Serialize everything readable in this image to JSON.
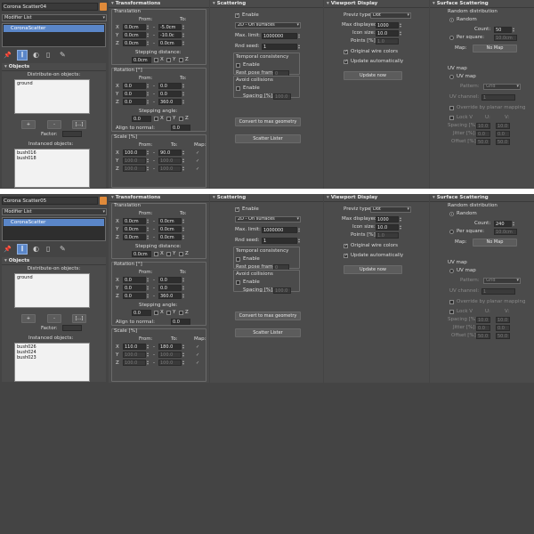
{
  "instances": [
    {
      "object_name": "Corona Scatter04",
      "color_swatch": "#e08a3a",
      "modifier_list": "Modifier List",
      "stack_item": "CoronaScatter",
      "objects": {
        "title": "Objects",
        "distribute_label": "Distribute-on objects:",
        "distribute_items": [
          "ground"
        ],
        "plus": "+",
        "minus": "-",
        "more": "[...]",
        "factor_label": "Factor:",
        "factor_value": "",
        "instanced_label": "Instanced objects:",
        "instanced_items": [
          "bush016",
          "bush018"
        ]
      },
      "transformations": {
        "title": "Transformations",
        "translation": "Translation",
        "from": "From:",
        "to": "To:",
        "tx_from": [
          "0.0cm",
          "0.0cm",
          "0.0cm"
        ],
        "tx_to": [
          "-5.0cm",
          "-10.0c",
          "0.0cm"
        ],
        "stepping_distance": "Stepping distance:",
        "step_dist": "0.0cm",
        "axis_x": "X",
        "axis_y": "Y",
        "axis_z": "Z",
        "rotation": "Rotation [°]",
        "rot_from": [
          "0.0",
          "0.0",
          "0.0"
        ],
        "rot_to": [
          "0.0",
          "0.0",
          "360.0"
        ],
        "stepping_angle": "Stepping angle:",
        "step_angle": "0.0",
        "align_normal": "Align to normal:",
        "align_val": "0.0",
        "scale": "Scale [%]",
        "map": "Map:",
        "sc_from": [
          "100.0",
          "100.0",
          "100.0"
        ],
        "sc_to": [
          "90.0",
          "100.0",
          "100.0"
        ]
      },
      "scattering": {
        "title": "Scattering",
        "enable": "Enable",
        "mode": "2D - On surfaces",
        "max_limit_label": "Max. limit:",
        "max_limit": "1000000",
        "rnd_seed_label": "Rnd seed:",
        "rnd_seed": "1",
        "temporal": "Temporal consistency",
        "t_enable": "Enable",
        "rest_pose": "Rest pose frame",
        "rest_pose_val": "0",
        "avoid": "Avoid collisions",
        "a_enable": "Enable",
        "spacing": "Spacing [%]:",
        "spacing_val": "100.0",
        "convert": "Convert to max geometry",
        "lister": "Scatter Lister"
      },
      "viewport": {
        "title": "Viewport Display",
        "previz_label": "Previz type:",
        "previz": "Dot",
        "max_disp_label": "Max displayed:",
        "max_disp": "1000",
        "icon_size_label": "Icon size:",
        "icon_size": "10.0",
        "points_label": "Points [%]:",
        "points": "1.0",
        "orig_wire": "Original wire colors",
        "update_auto": "Update automatically",
        "update_now": "Update now"
      },
      "surface": {
        "title": "Surface Scattering",
        "random_dist": "Random distribution",
        "random": "Random",
        "count_label": "Count:",
        "count": "50",
        "per_square": "Per square:",
        "per_square_val": "10.0cm",
        "map_label": "Map:",
        "no_map": "No Map",
        "uv_map_group": "UV map",
        "uv_map": "UV map",
        "pattern_label": "Pattern:",
        "pattern": "Grid",
        "uv_channel_label": "UV channel:",
        "uv_channel": "1",
        "override": "Override by planar mapping",
        "lock": "Lock V",
        "u": "U:",
        "v": "V:",
        "spacing_label": "Spacing [%]:",
        "jitter_label": "Jitter [%]:",
        "offset_label": "Offset [%]:",
        "spacing_u": "10.0",
        "spacing_v": "10.0",
        "jitter_u": "0.0",
        "jitter_v": "0.0",
        "offset_u": "50.0",
        "offset_v": "50.0"
      }
    },
    {
      "object_name": "Corona Scatter05",
      "color_swatch": "#e08a3a",
      "modifier_list": "Modifier List",
      "stack_item": "CoronaScatter",
      "objects": {
        "title": "Objects",
        "distribute_label": "Distribute-on objects:",
        "distribute_items": [
          "ground"
        ],
        "plus": "+",
        "minus": "-",
        "more": "[...]",
        "factor_label": "Factor:",
        "factor_value": "",
        "instanced_label": "Instanced objects:",
        "instanced_items": [
          "bush026",
          "bush024",
          "bush023"
        ]
      },
      "transformations": {
        "title": "Transformations",
        "translation": "Translation",
        "from": "From:",
        "to": "To:",
        "tx_from": [
          "0.0cm",
          "0.0cm",
          "0.0cm"
        ],
        "tx_to": [
          "0.0cm",
          "0.0cm",
          "0.0cm"
        ],
        "stepping_distance": "Stepping distance:",
        "step_dist": "0.0cm",
        "axis_x": "X",
        "axis_y": "Y",
        "axis_z": "Z",
        "rotation": "Rotation [°]",
        "rot_from": [
          "0.0",
          "0.0",
          "0.0"
        ],
        "rot_to": [
          "0.0",
          "0.0",
          "360.0"
        ],
        "stepping_angle": "Stepping angle:",
        "step_angle": "0.0",
        "align_normal": "Align to normal:",
        "align_val": "0.0",
        "scale": "Scale [%]",
        "map": "Map:",
        "sc_from": [
          "110.0",
          "100.0",
          "100.0"
        ],
        "sc_to": [
          "180.0",
          "100.0",
          "100.0"
        ]
      },
      "scattering": {
        "title": "Scattering",
        "enable": "Enable",
        "mode": "2D - On surfaces",
        "max_limit_label": "Max. limit:",
        "max_limit": "1000000",
        "rnd_seed_label": "Rnd seed:",
        "rnd_seed": "1",
        "temporal": "Temporal consistency",
        "t_enable": "Enable",
        "rest_pose": "Rest pose frame",
        "rest_pose_val": "0",
        "avoid": "Avoid collisions",
        "a_enable": "Enable",
        "spacing": "Spacing [%]:",
        "spacing_val": "100.0",
        "convert": "Convert to max geometry",
        "lister": "Scatter Lister"
      },
      "viewport": {
        "title": "Viewport Display",
        "previz_label": "Previz type:",
        "previz": "Dot",
        "max_disp_label": "Max displayed:",
        "max_disp": "1000",
        "icon_size_label": "Icon size:",
        "icon_size": "10.0",
        "points_label": "Points [%]:",
        "points": "1.0",
        "orig_wire": "Original wire colors",
        "update_auto": "Update automatically",
        "update_now": "Update now"
      },
      "surface": {
        "title": "Surface Scattering",
        "random_dist": "Random distribution",
        "random": "Random",
        "count_label": "Count:",
        "count": "240",
        "per_square": "Per square:",
        "per_square_val": "10.0cm",
        "map_label": "Map:",
        "no_map": "No Map",
        "uv_map_group": "UV map",
        "uv_map": "UV map",
        "pattern_label": "Pattern:",
        "pattern": "Grid",
        "uv_channel_label": "UV channel:",
        "uv_channel": "1",
        "override": "Override by planar mapping",
        "lock": "Lock V",
        "u": "U:",
        "v": "V:",
        "spacing_label": "Spacing [%]:",
        "jitter_label": "Jitter [%]:",
        "offset_label": "Offset [%]:",
        "spacing_u": "10.0",
        "spacing_v": "10.0",
        "jitter_u": "0.0",
        "jitter_v": "0.0",
        "offset_u": "50.0",
        "offset_v": "50.0"
      }
    }
  ]
}
